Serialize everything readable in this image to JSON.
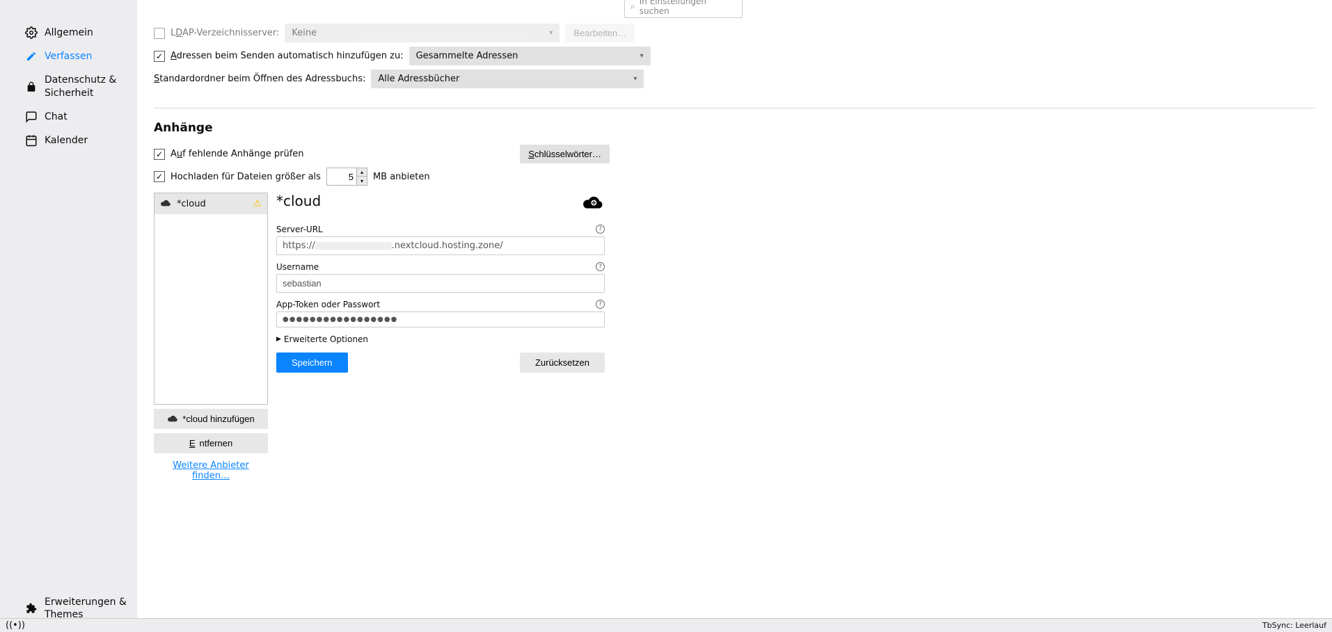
{
  "search": {
    "placeholder": "In Einstellungen suchen"
  },
  "sidebar": {
    "items": [
      {
        "label": "Allgemein"
      },
      {
        "label": "Verfassen"
      },
      {
        "label": "Datenschutz & Sicherheit"
      },
      {
        "label": "Chat"
      },
      {
        "label": "Kalender"
      }
    ],
    "footer": {
      "label": "Erweiterungen & Themes"
    }
  },
  "address_section": {
    "ldap_label_partial": "AP-Verzeichnisserver:",
    "ldap_value": "Keine",
    "ldap_edit": "Bearbeiten…",
    "auto_add_label": "dressen beim Senden automatisch hinzufügen zu:",
    "auto_add_value": "Gesammelte Adressen",
    "default_folder_label": "tandardordner beim Öffnen des Adressbuchs:",
    "default_folder_value": "Alle Adressbücher"
  },
  "attachments": {
    "title": "Anhänge",
    "check_missing": "f fehlende Anhänge prüfen",
    "keywords_btn": "chlüsselwörter…",
    "upload_label_pre": "Hochladen für Dateien größer als",
    "upload_value": "5",
    "upload_label_post": "MB anbieten"
  },
  "providers": {
    "item_label": "*cloud",
    "add_btn": "*cloud hinzufügen",
    "remove_btn": "ntfernen",
    "more_link": "Weitere Anbieter finden…"
  },
  "detail": {
    "title": "*cloud",
    "server_url_label": "Server-URL",
    "server_url_prefix": "https://",
    "server_url_suffix": ".nextcloud.hosting.zone/",
    "username_label": "Username",
    "username_value": "sebastian",
    "password_label": "App-Token oder Passwort",
    "password_value": "●●●●●●●●●●●●●●●●●",
    "advanced": "Erweiterte Optionen",
    "save": "Speichern",
    "reset": "Zurücksetzen"
  },
  "statusbar": {
    "right": "TbSync: Leerlauf"
  }
}
